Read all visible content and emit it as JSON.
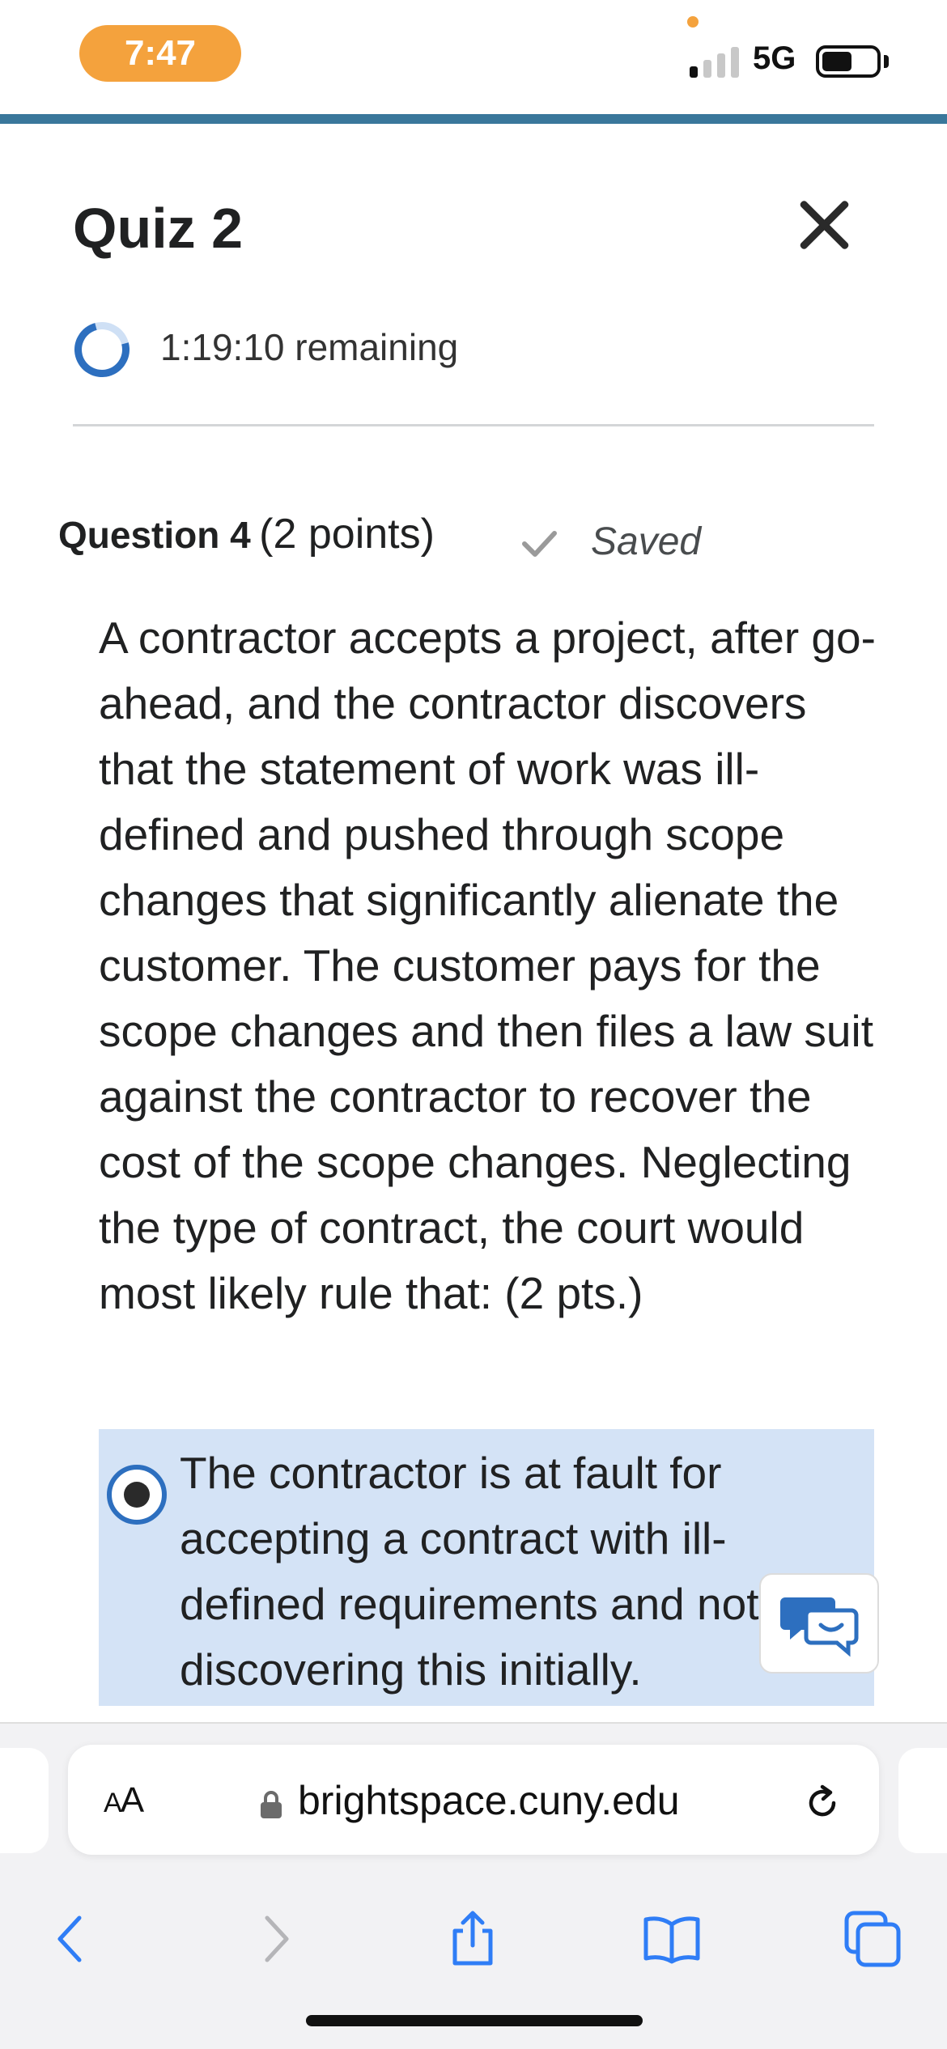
{
  "status_bar": {
    "time": "7:47",
    "network": "5G"
  },
  "colors": {
    "accent_bar": "#3a779b",
    "time_pill": "#f4a23d",
    "selected_option_bg": "#d4e3f6",
    "brand_blue": "#2d6fbf"
  },
  "quiz": {
    "title": "Quiz 2",
    "timer_remaining": "1:19:10 remaining"
  },
  "question": {
    "label": "Question 4",
    "points": "(2 points)",
    "saved_status": "Saved",
    "text": "A contractor accepts a project, after go-ahead, and the contractor discovers that the statement of work was ill-defined and pushed through scope changes that significantly alienate the customer. The customer pays for the scope changes and then files a law suit against the contractor to recover the cost of the scope changes. Neglecting the type of contract, the court would most likely rule that: (2 pts.)",
    "options": [
      {
        "text": "The contractor is at fault for accepting a contract with ill-defined requirements and not discovering this initially.",
        "selected": true
      }
    ]
  },
  "browser": {
    "aa_label_big": "A",
    "aa_label_small": "A",
    "url": "brightspace.cuny.edu"
  },
  "icons": {
    "close": "close-icon",
    "timer": "timer-progress-icon",
    "saved": "checkmark-icon",
    "chat": "chat-bubbles-icon",
    "lock": "lock-icon",
    "reload": "reload-icon",
    "back": "chevron-left-icon",
    "forward": "chevron-right-icon",
    "share": "share-icon",
    "bookmarks": "book-icon",
    "tabs": "tabs-icon"
  }
}
